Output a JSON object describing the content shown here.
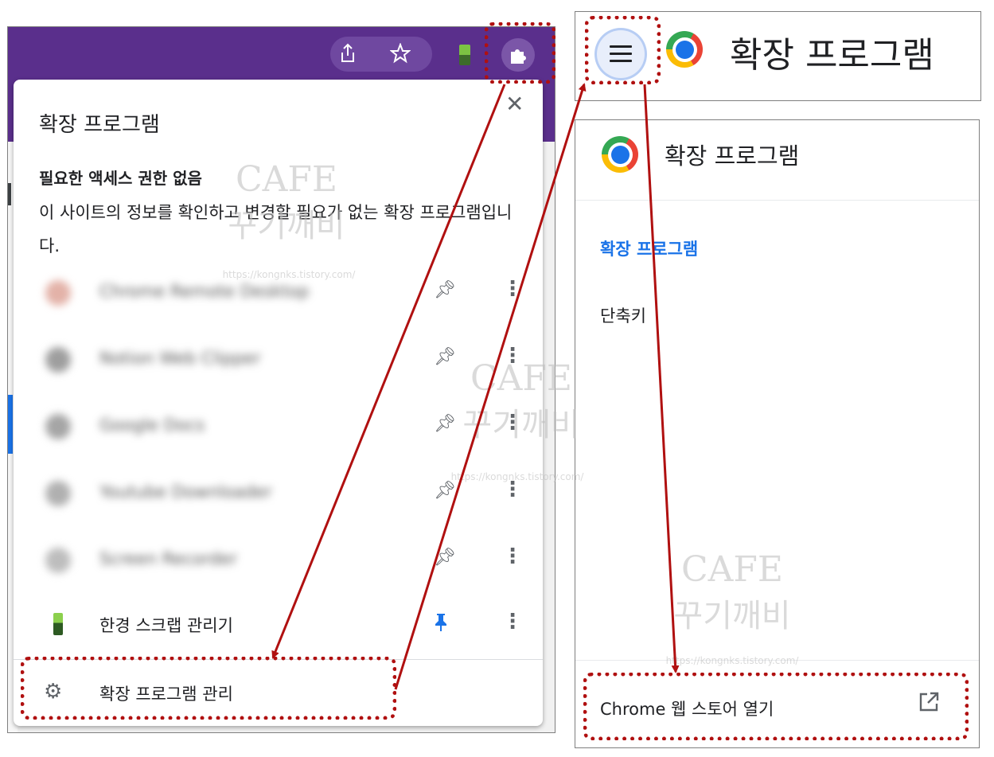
{
  "left": {
    "toolbar": {
      "share_icon": "share-icon",
      "star_icon": "bookmark-star-icon",
      "puzzle_icon": "puzzle-icon"
    },
    "popup": {
      "title": "확장 프로그램",
      "close_icon": "close-icon",
      "section_heading": "필요한 액세스 권한 없음",
      "section_desc": "이 사이트의 정보를 확인하고 변경할 필요가 없는 확장 프로그램입니다.",
      "blurred_extensions": [
        {
          "label": "Chrome Remote Desktop"
        },
        {
          "label": "Notion Web Clipper"
        },
        {
          "label": "Google Docs"
        },
        {
          "label": "Youtube Downloader"
        },
        {
          "label": "Screen Recorder"
        }
      ],
      "extension": {
        "name": "한경 스크랩 관리기",
        "pinned": true
      },
      "manage_label": "확장 프로그램 관리"
    }
  },
  "right": {
    "top_title": "확장 프로그램",
    "header_title": "확장 프로그램",
    "nav": {
      "extensions": "확장 프로그램",
      "shortcuts": "단축키"
    },
    "store_label": "Chrome 웹 스토어 열기"
  },
  "watermark": {
    "cafe": "CAFE",
    "korean": "꾸기깨비",
    "url": "https://kongnks.tistory.com/"
  },
  "colors": {
    "annotation": "#b01010",
    "accent": "#1a73e8",
    "toolbar": "#5a2f8c"
  }
}
